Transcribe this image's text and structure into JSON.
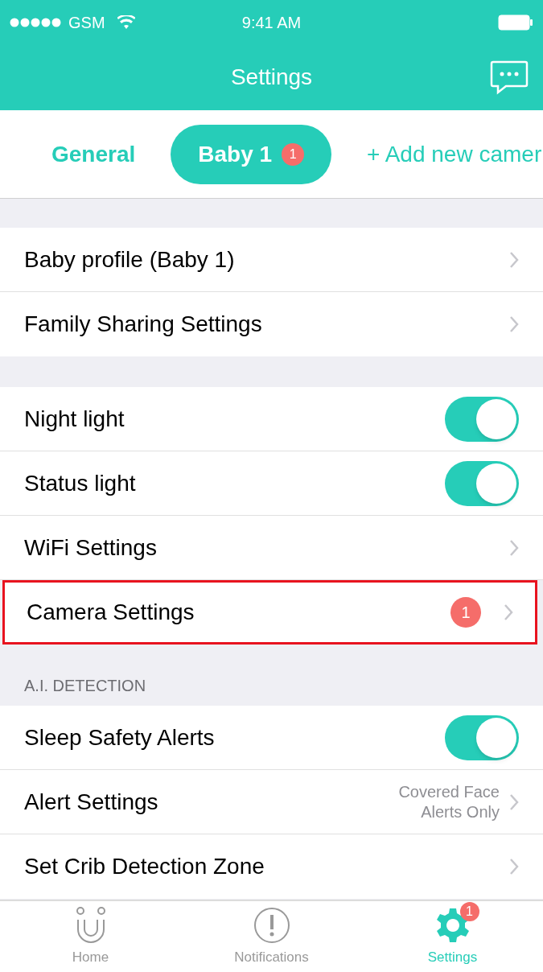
{
  "status_bar": {
    "carrier": "GSM",
    "time": "9:41 AM"
  },
  "nav": {
    "title": "Settings"
  },
  "tabs": [
    {
      "label": "General",
      "selected": false
    },
    {
      "label": "Baby 1",
      "selected": true,
      "badge": "1"
    },
    {
      "label": "+ Add new camer",
      "selected": false
    }
  ],
  "sections": [
    {
      "rows": [
        {
          "kind": "link",
          "label": "Baby profile (Baby 1)"
        },
        {
          "kind": "link",
          "label": "Family Sharing Settings"
        }
      ]
    },
    {
      "rows": [
        {
          "kind": "toggle",
          "label": "Night light",
          "on": true
        },
        {
          "kind": "toggle",
          "label": "Status light",
          "on": true
        },
        {
          "kind": "link",
          "label": "WiFi Settings"
        },
        {
          "kind": "link",
          "label": "Camera Settings",
          "badge": "1",
          "highlighted": true
        }
      ]
    },
    {
      "header": "A.I. DETECTION",
      "rows": [
        {
          "kind": "toggle",
          "label": "Sleep Safety Alerts",
          "on": true
        },
        {
          "kind": "link",
          "label": "Alert Settings",
          "value": "Covered Face Alerts Only"
        },
        {
          "kind": "link",
          "label": "Set Crib Detection Zone"
        }
      ]
    }
  ],
  "tab_bar": [
    {
      "kind": "home",
      "label": "Home",
      "selected": false
    },
    {
      "kind": "notifications",
      "label": "Notifications",
      "selected": false
    },
    {
      "kind": "settings",
      "label": "Settings",
      "selected": true,
      "badge": "1"
    }
  ]
}
